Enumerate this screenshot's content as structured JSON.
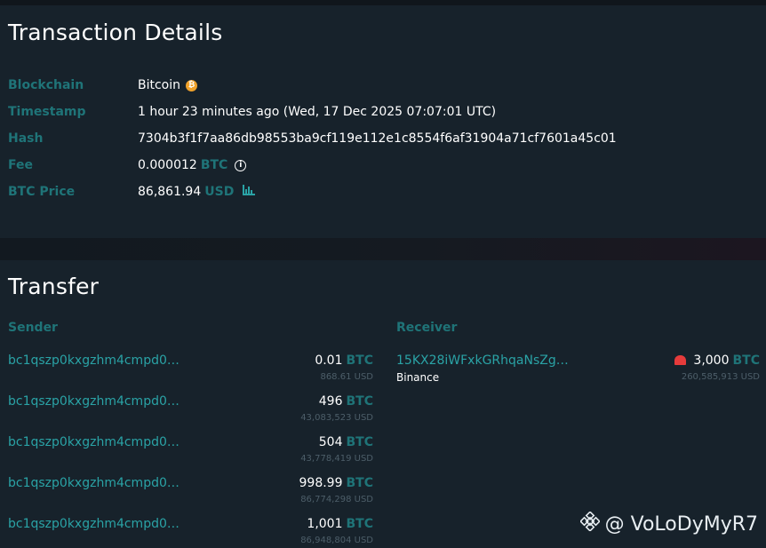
{
  "details": {
    "title": "Transaction Details",
    "fields": {
      "blockchain": {
        "label": "Blockchain",
        "value": "Bitcoin",
        "coin_icon": "bitcoin-coin-icon",
        "coin_color": "#f0a22b"
      },
      "timestamp": {
        "label": "Timestamp",
        "value": "1 hour 23 minutes ago (Wed, 17 Dec 2025 07:07:01 UTC)"
      },
      "hash": {
        "label": "Hash",
        "value": "7304b3f1f7aa86db98553ba9cf119e112e1c8554f6af31904a71cf7601a45c01"
      },
      "fee": {
        "label": "Fee",
        "value": "0.000012",
        "unit": "BTC",
        "icon": "info-icon"
      },
      "btc_price": {
        "label": "BTC Price",
        "value": "86,861.94",
        "unit": "USD",
        "icon": "bar-chart-icon"
      }
    }
  },
  "transfer": {
    "title": "Transfer",
    "sender_header": "Sender",
    "receiver_header": "Receiver",
    "senders": [
      {
        "address": "bc1qszp0kxgzhm4cmpd0…",
        "amount": "0.01",
        "unit": "BTC",
        "usd": "868.61 USD"
      },
      {
        "address": "bc1qszp0kxgzhm4cmpd0…",
        "amount": "496",
        "unit": "BTC",
        "usd": "43,083,523 USD"
      },
      {
        "address": "bc1qszp0kxgzhm4cmpd0…",
        "amount": "504",
        "unit": "BTC",
        "usd": "43,778,419 USD"
      },
      {
        "address": "bc1qszp0kxgzhm4cmpd0…",
        "amount": "998.99",
        "unit": "BTC",
        "usd": "86,774,298 USD"
      },
      {
        "address": "bc1qszp0kxgzhm4cmpd0…",
        "amount": "1,001",
        "unit": "BTC",
        "usd": "86,948,804 USD"
      }
    ],
    "receivers": [
      {
        "address": "15KX28iWFxkGRhqaNsZg…",
        "entity": "Binance",
        "amount": "3,000",
        "unit": "BTC",
        "usd": "260,585,913 USD",
        "alert_icon": "alarm-siren-icon"
      }
    ]
  },
  "watermark": {
    "text": "@ VoLoDyMyR7",
    "icon": "binance-logo-icon"
  },
  "colors": {
    "accent": "#2aa3a6",
    "label": "#1f7478",
    "background": "#17222b"
  }
}
